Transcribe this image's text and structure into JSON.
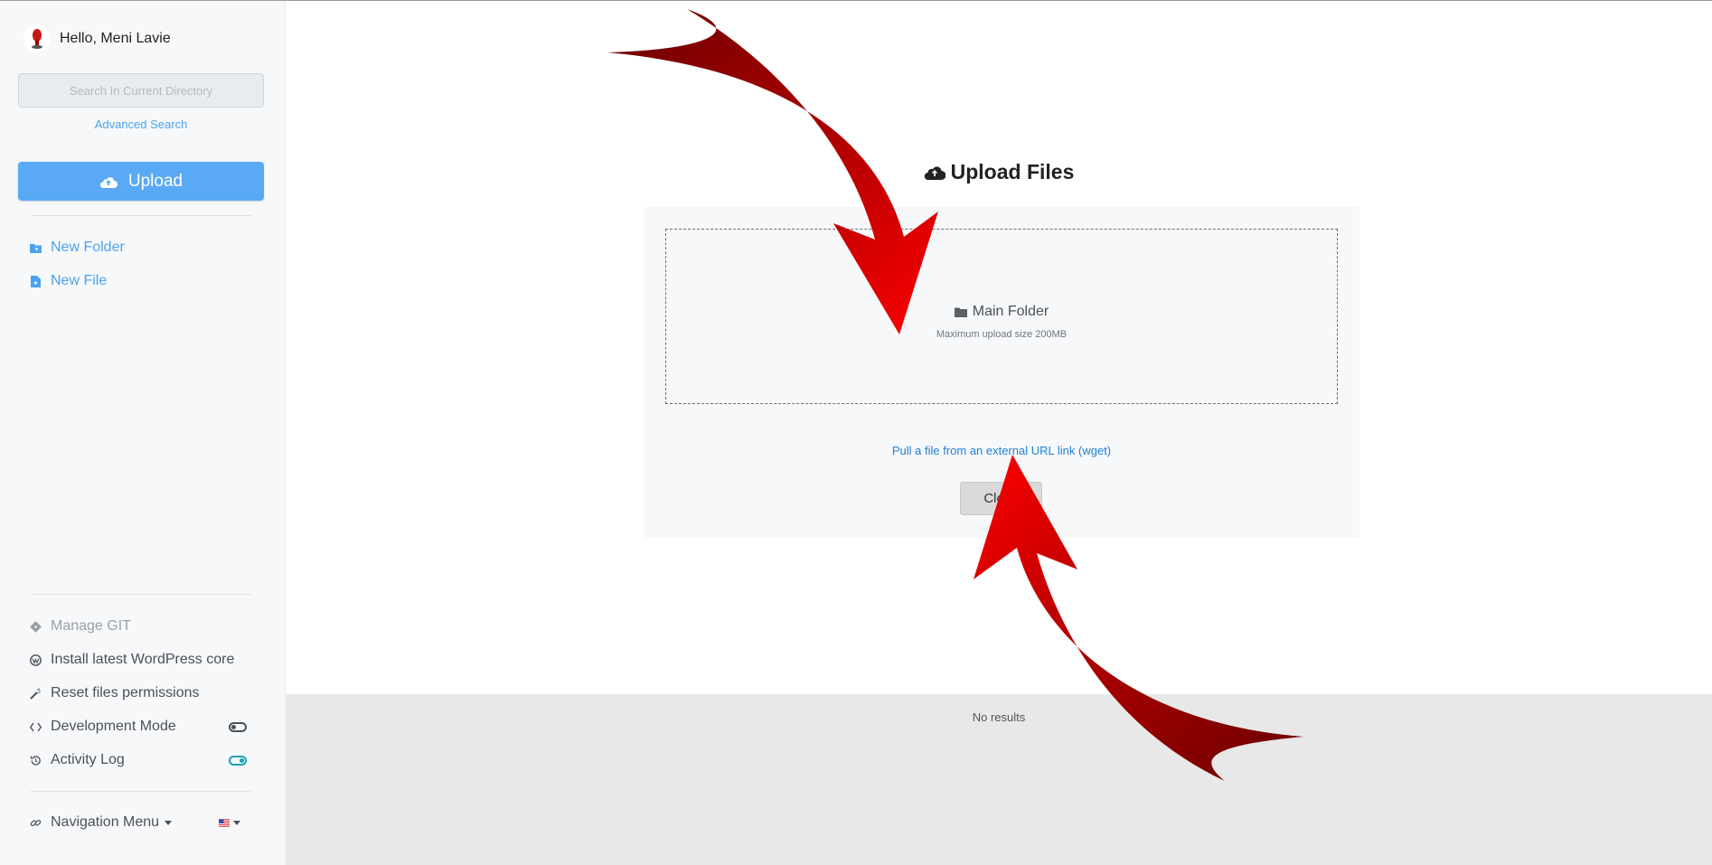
{
  "sidebar": {
    "greeting": "Hello, Meni Lavie",
    "search_placeholder": "Search In Current Directory",
    "advanced_search": "Advanced Search",
    "upload_label": "Upload",
    "new_folder": "New Folder",
    "new_file": "New File",
    "manage_git": "Manage GIT",
    "install_wp": "Install latest WordPress core",
    "reset_permissions": "Reset files permissions",
    "dev_mode": "Development Mode",
    "dev_mode_on": false,
    "activity_log": "Activity Log",
    "activity_log_on": true,
    "nav_menu": "Navigation Menu",
    "language_flag": "us-flag-icon"
  },
  "upload_dialog": {
    "title": "Upload Files",
    "folder_label": "Main Folder",
    "max_size": "Maximum upload size 200MB",
    "wget_link": "Pull a file from an external URL link (wget)",
    "close_label": "Close"
  },
  "results": {
    "empty_text": "No results"
  },
  "colors": {
    "accent": "#5aa9f5",
    "link": "#4aa3f0",
    "annotation_arrow": "#d40000"
  }
}
